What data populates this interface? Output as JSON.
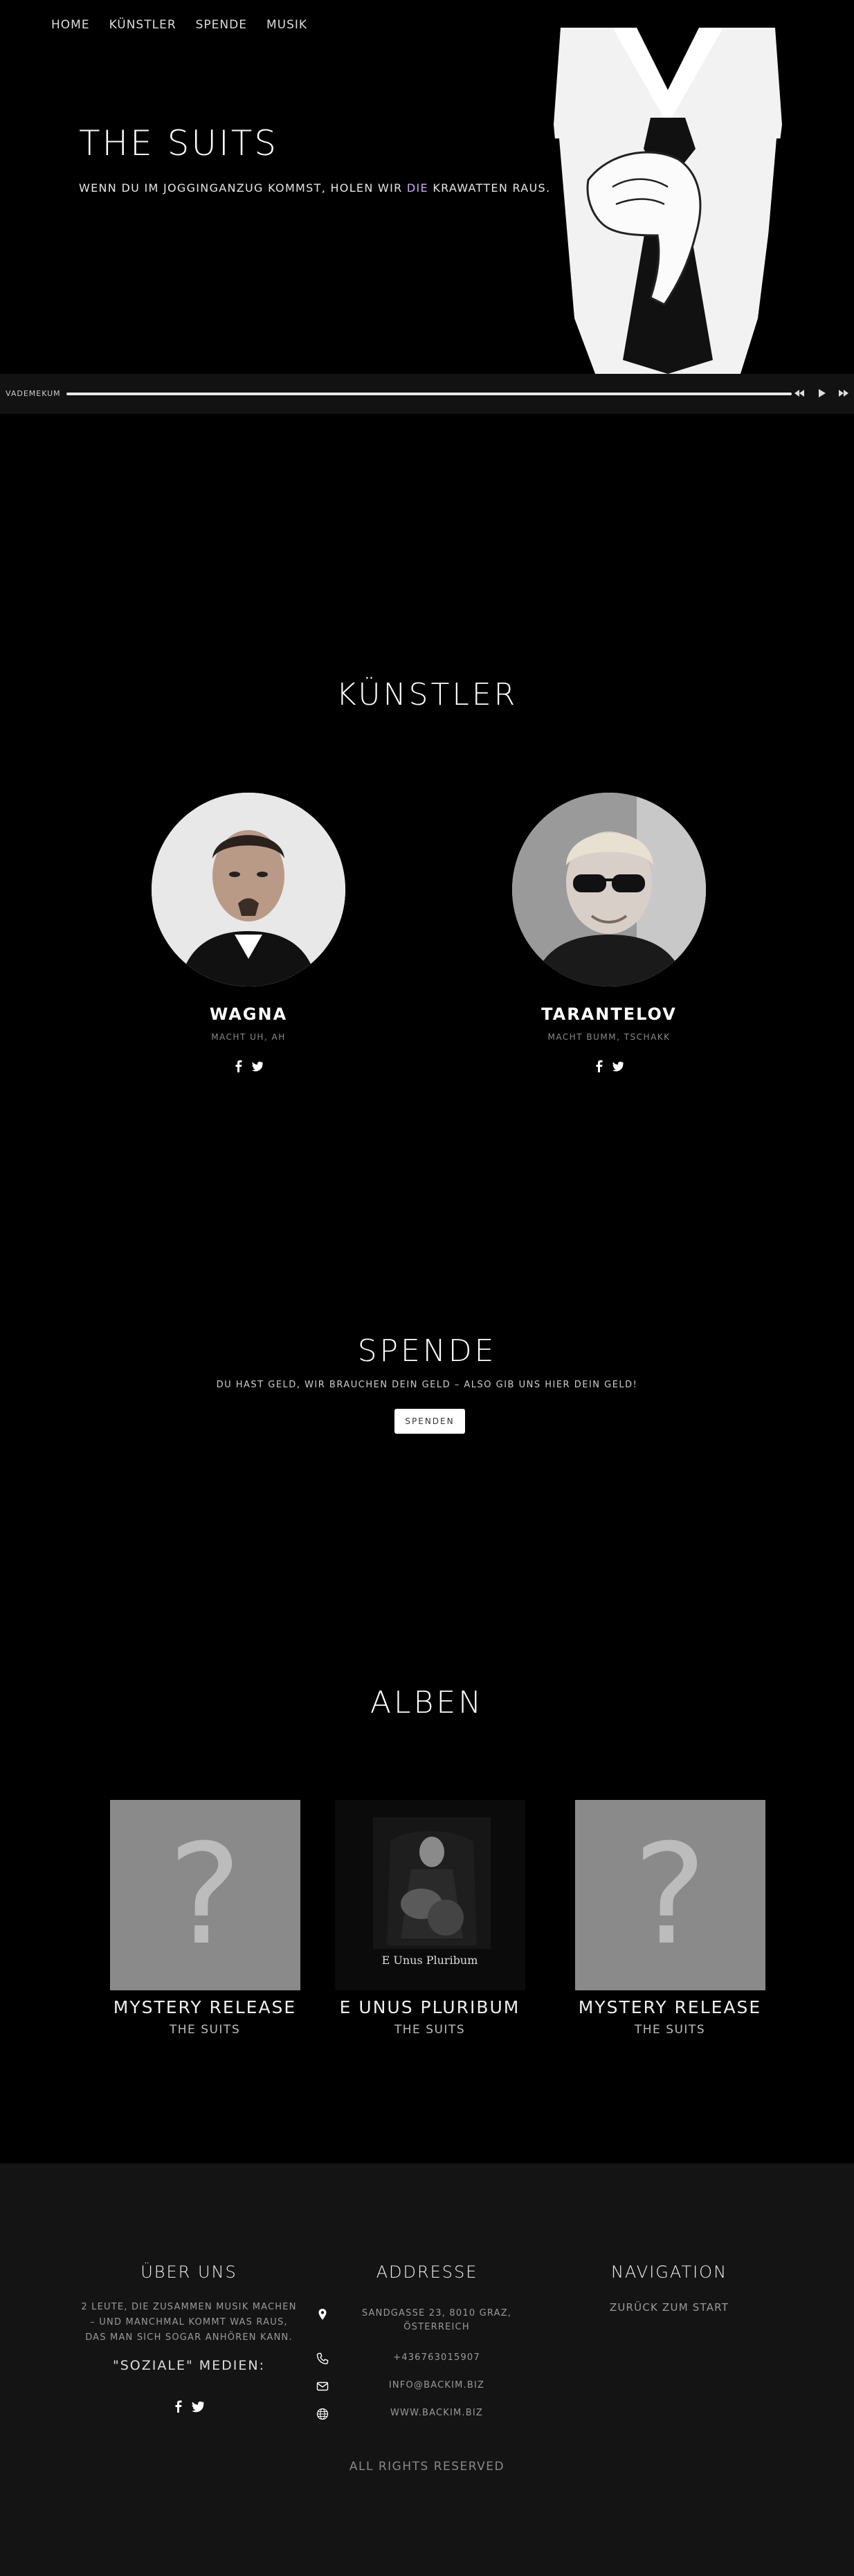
{
  "nav": {
    "items": [
      "HOME",
      "KÜNSTLER",
      "SPENDE",
      "MUSIK"
    ]
  },
  "hero": {
    "title": "THE SUITS",
    "subtitle_pre": "WENN DU IM JOGGINGANZUG KOMMST, HOLEN WIR ",
    "subtitle_accent": "DIE",
    "subtitle_post": " KRAWATTEN RAUS.",
    "accent_color": "#c9a8ff"
  },
  "player": {
    "track": "VADEMEKUM",
    "progress": 1.0,
    "buttons": [
      "prev-icon",
      "play-icon",
      "next-icon"
    ]
  },
  "artists": {
    "title": "KÜNSTLER",
    "items": [
      {
        "name": "WAGNA",
        "desc": "MACHT UH, AH"
      },
      {
        "name": "TARANTELOV",
        "desc": "MACHT BUMM, TSCHAKK"
      }
    ]
  },
  "donate": {
    "title": "SPENDE",
    "text": "DU HAST GELD, WIR BRAUCHEN DEIN GELD – ALSO GIB UNS HIER DEIN GELD!",
    "button": "SPENDEN"
  },
  "albums": {
    "title": "ALBEN",
    "items": [
      {
        "title": "MYSTERY RELEASE",
        "artist": "THE SUITS"
      },
      {
        "title": "E UNUS PLURIBUM",
        "artist": "THE SUITS",
        "cover_text": "E Unus Pluribum"
      },
      {
        "title": "MYSTERY RELEASE",
        "artist": "THE SUITS"
      }
    ]
  },
  "footer": {
    "about": {
      "title": "ÜBER UNS",
      "text": "2 LEUTE, DIE ZUSAMMEN MUSIK MACHEN – UND MANCHMAL KOMMT WAS RAUS, DAS MAN SICH SOGAR ANHÖREN KANN.",
      "social_label": "\"SOZIALE\" MEDIEN:"
    },
    "address": {
      "title": "ADDRESSE",
      "street": "SANDGASSE 23, 8010 GRAZ, ÖSTERREICH",
      "phone": "+436763015907",
      "email": "INFO@BACKIM.BIZ",
      "web": "WWW.BACKIM.BIZ"
    },
    "navigation": {
      "title": "NAVIGATION",
      "link": "ZURÜCK ZUM START"
    },
    "rights": "ALL RIGHTS RESERVED"
  }
}
